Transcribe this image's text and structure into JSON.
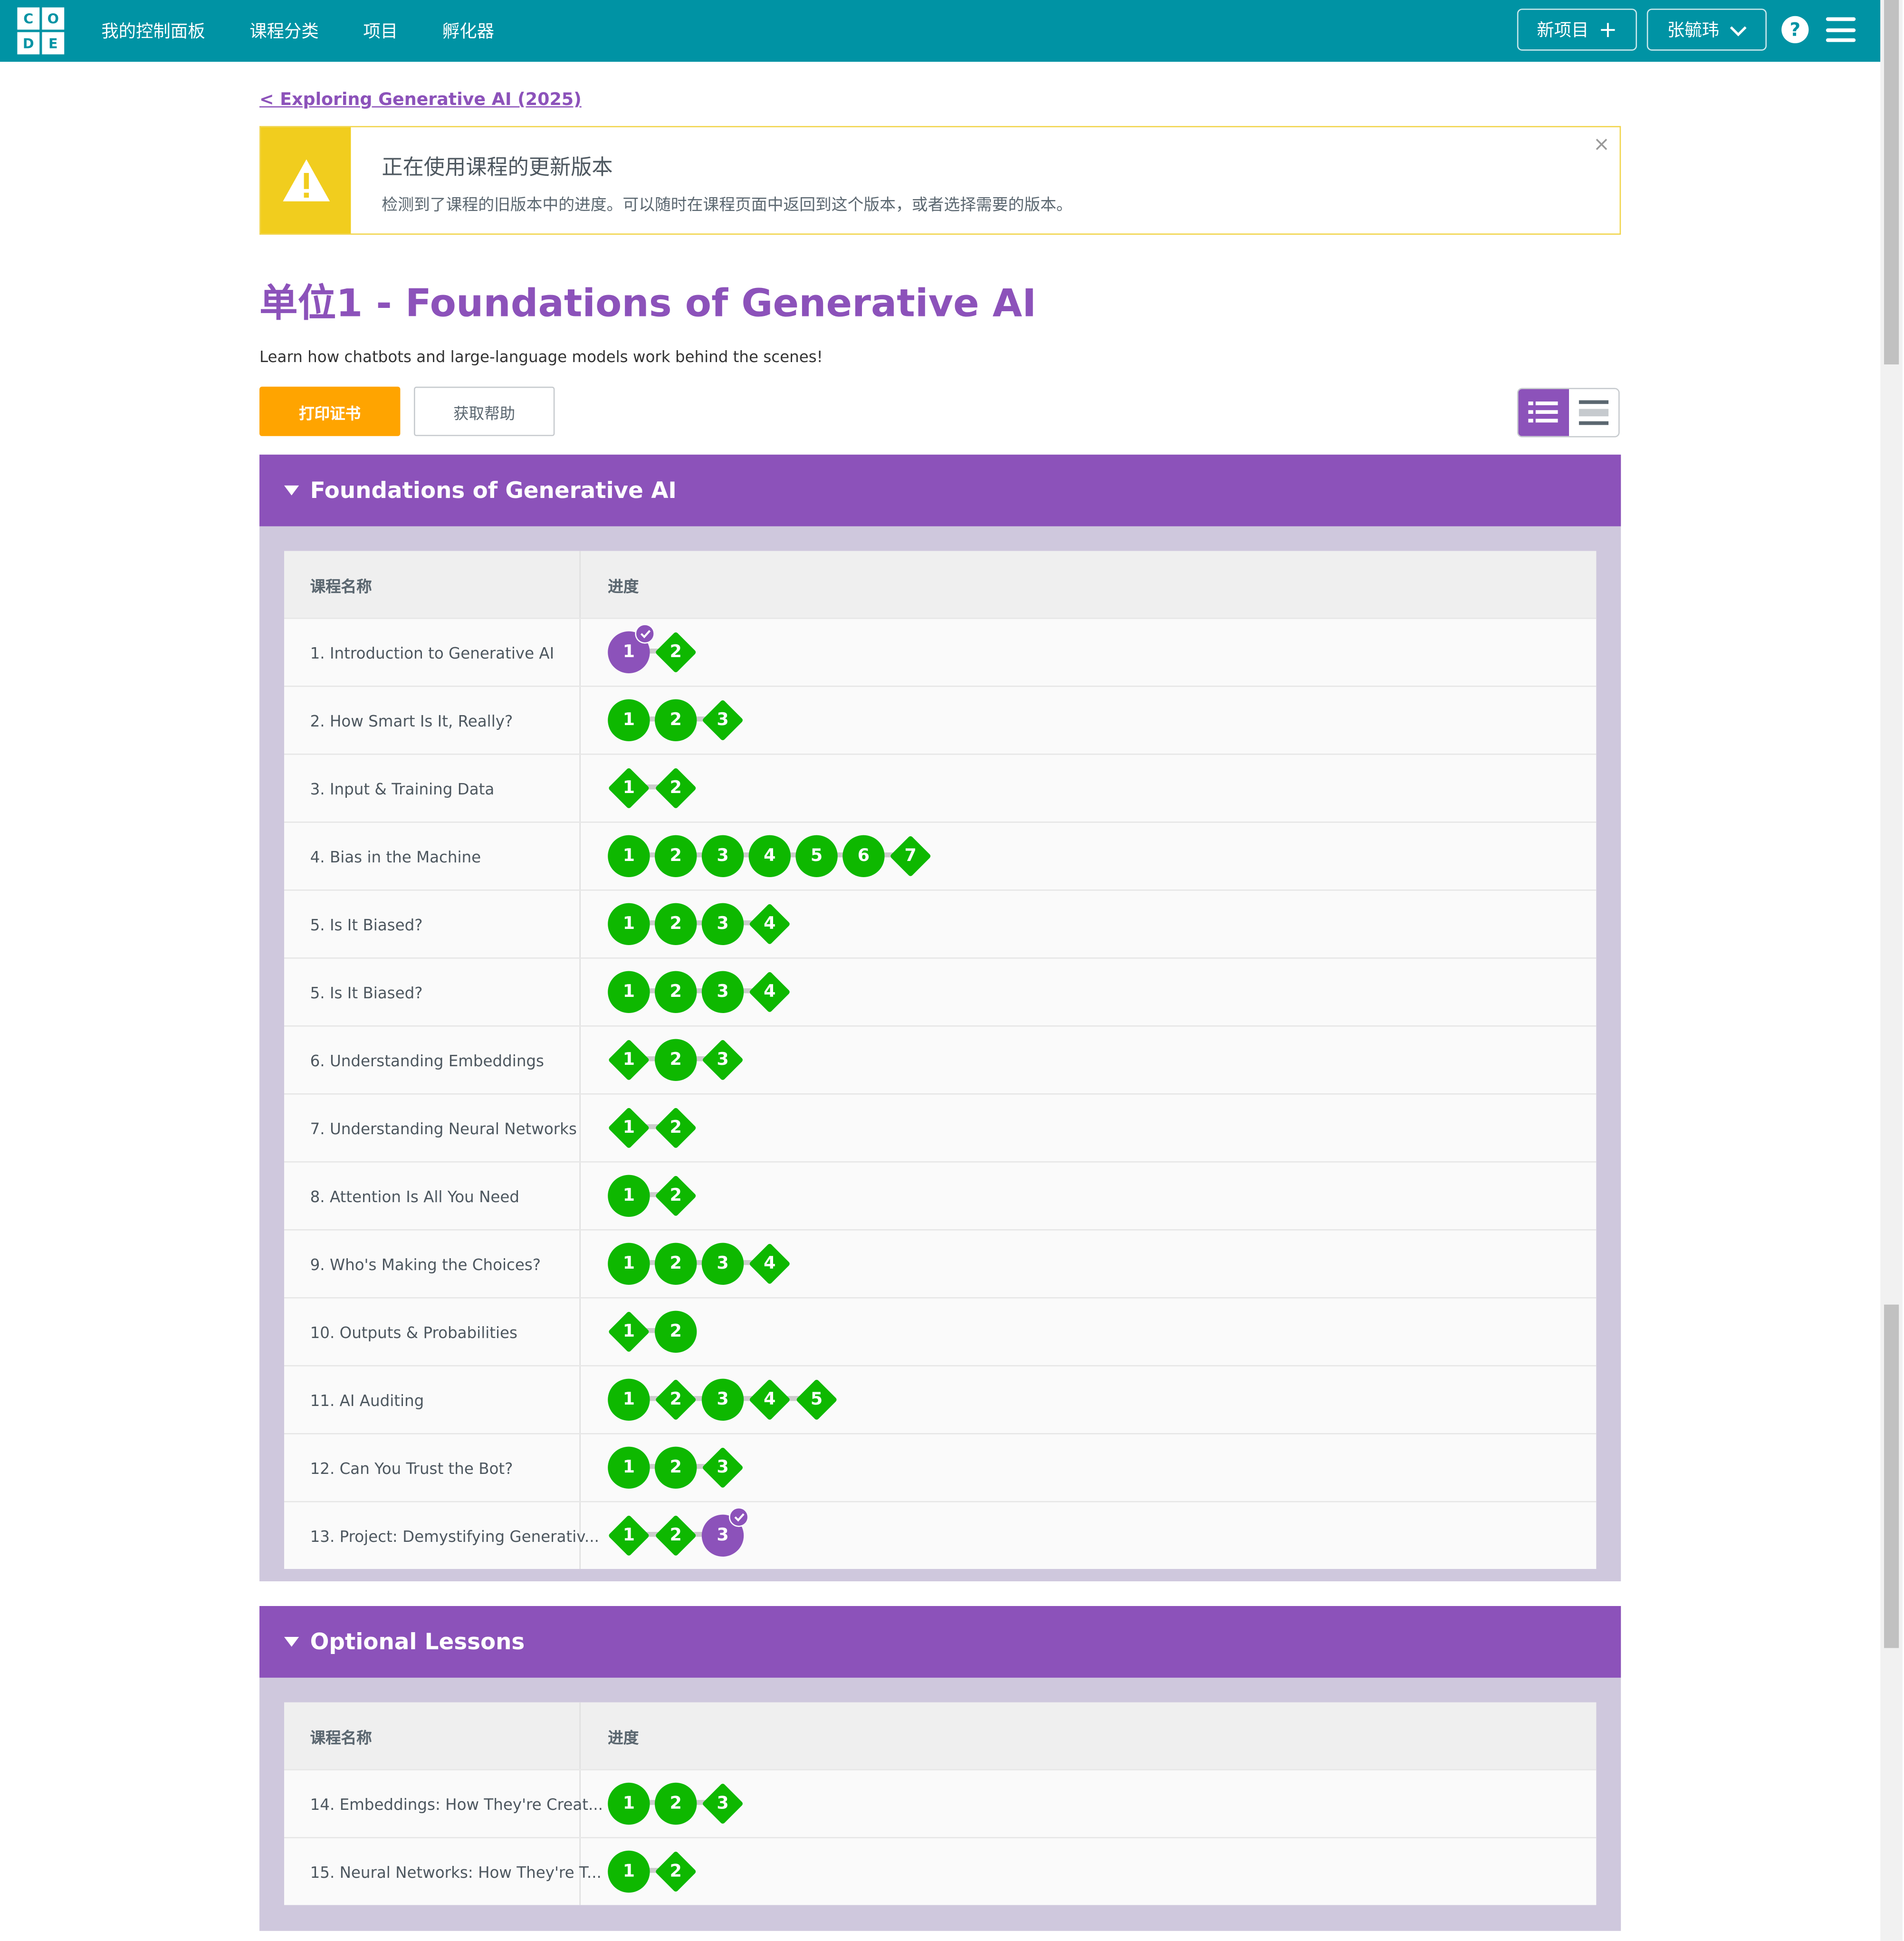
{
  "nav": {
    "logo_letters": [
      "C",
      "O",
      "D",
      "E"
    ],
    "links": [
      "我的控制面板",
      "课程分类",
      "项目",
      "孵化器"
    ],
    "new_project": "新项目",
    "user_name": "张毓玮",
    "help_glyph": "?"
  },
  "back_link": "< Exploring Generative AI (2025)",
  "notice": {
    "title": "正在使用课程的更新版本",
    "body": "检测到了课程的旧版本中的进度。可以随时在课程页面中返回到这个版本，或者选择需要的版本。",
    "close_glyph": "×"
  },
  "unit": {
    "title": "单位1 - Foundations of Generative AI",
    "description": "Learn how chatbots and large-language models work behind the scenes!"
  },
  "buttons": {
    "print": "打印证书",
    "help": "获取帮助"
  },
  "colors": {
    "brand_teal": "#0093a4",
    "accent_purple": "#8c52ba",
    "complete_green": "#0eb800",
    "warning_yellow": "#f1cd1e",
    "print_orange": "#ffa400"
  },
  "sections": [
    {
      "title": "Foundations of Generative AI",
      "col_name": "课程名称",
      "col_progress": "进度",
      "lessons": [
        {
          "name": "1. Introduction to Generative AI",
          "levels": [
            {
              "n": "1",
              "shape": "circle",
              "state": "current"
            },
            {
              "n": "2",
              "shape": "diamond",
              "state": "complete"
            }
          ]
        },
        {
          "name": "2. How Smart Is It, Really?",
          "levels": [
            {
              "n": "1",
              "shape": "circle",
              "state": "complete"
            },
            {
              "n": "2",
              "shape": "circle",
              "state": "complete"
            },
            {
              "n": "3",
              "shape": "diamond",
              "state": "complete"
            }
          ]
        },
        {
          "name": "3. Input & Training Data",
          "levels": [
            {
              "n": "1",
              "shape": "diamond",
              "state": "complete"
            },
            {
              "n": "2",
              "shape": "diamond",
              "state": "complete"
            }
          ]
        },
        {
          "name": "4. Bias in the Machine",
          "levels": [
            {
              "n": "1",
              "shape": "circle",
              "state": "complete"
            },
            {
              "n": "2",
              "shape": "circle",
              "state": "complete"
            },
            {
              "n": "3",
              "shape": "circle",
              "state": "complete"
            },
            {
              "n": "4",
              "shape": "circle",
              "state": "complete"
            },
            {
              "n": "5",
              "shape": "circle",
              "state": "complete"
            },
            {
              "n": "6",
              "shape": "circle",
              "state": "complete"
            },
            {
              "n": "7",
              "shape": "diamond",
              "state": "complete"
            }
          ]
        },
        {
          "name": "5. Is It Biased?",
          "levels": [
            {
              "n": "1",
              "shape": "circle",
              "state": "complete"
            },
            {
              "n": "2",
              "shape": "circle",
              "state": "complete"
            },
            {
              "n": "3",
              "shape": "circle",
              "state": "complete"
            },
            {
              "n": "4",
              "shape": "diamond",
              "state": "complete"
            }
          ]
        },
        {
          "name": "5. Is It Biased?",
          "levels": [
            {
              "n": "1",
              "shape": "circle",
              "state": "complete"
            },
            {
              "n": "2",
              "shape": "circle",
              "state": "complete"
            },
            {
              "n": "3",
              "shape": "circle",
              "state": "complete"
            },
            {
              "n": "4",
              "shape": "diamond",
              "state": "complete"
            }
          ]
        },
        {
          "name": "6. Understanding Embeddings",
          "levels": [
            {
              "n": "1",
              "shape": "diamond",
              "state": "complete"
            },
            {
              "n": "2",
              "shape": "circle",
              "state": "complete"
            },
            {
              "n": "3",
              "shape": "diamond",
              "state": "complete"
            }
          ]
        },
        {
          "name": "7. Understanding Neural Networks",
          "levels": [
            {
              "n": "1",
              "shape": "diamond",
              "state": "complete"
            },
            {
              "n": "2",
              "shape": "diamond",
              "state": "complete"
            }
          ]
        },
        {
          "name": "8. Attention Is All You Need",
          "levels": [
            {
              "n": "1",
              "shape": "circle",
              "state": "complete"
            },
            {
              "n": "2",
              "shape": "diamond",
              "state": "complete"
            }
          ]
        },
        {
          "name": "9. Who's Making the Choices?",
          "levels": [
            {
              "n": "1",
              "shape": "circle",
              "state": "complete"
            },
            {
              "n": "2",
              "shape": "circle",
              "state": "complete"
            },
            {
              "n": "3",
              "shape": "circle",
              "state": "complete"
            },
            {
              "n": "4",
              "shape": "diamond",
              "state": "complete"
            }
          ]
        },
        {
          "name": "10. Outputs & Probabilities",
          "levels": [
            {
              "n": "1",
              "shape": "diamond",
              "state": "complete"
            },
            {
              "n": "2",
              "shape": "circle",
              "state": "complete"
            }
          ]
        },
        {
          "name": "11. AI Auditing",
          "levels": [
            {
              "n": "1",
              "shape": "circle",
              "state": "complete"
            },
            {
              "n": "2",
              "shape": "diamond",
              "state": "complete"
            },
            {
              "n": "3",
              "shape": "circle",
              "state": "complete"
            },
            {
              "n": "4",
              "shape": "diamond",
              "state": "complete"
            },
            {
              "n": "5",
              "shape": "diamond",
              "state": "complete"
            }
          ]
        },
        {
          "name": "12. Can You Trust the Bot?",
          "levels": [
            {
              "n": "1",
              "shape": "circle",
              "state": "complete"
            },
            {
              "n": "2",
              "shape": "circle",
              "state": "complete"
            },
            {
              "n": "3",
              "shape": "diamond",
              "state": "complete"
            }
          ]
        },
        {
          "name": "13. Project: Demystifying Generativ...",
          "levels": [
            {
              "n": "1",
              "shape": "diamond",
              "state": "complete"
            },
            {
              "n": "2",
              "shape": "diamond",
              "state": "complete"
            },
            {
              "n": "3",
              "shape": "circle",
              "state": "current"
            }
          ]
        }
      ]
    },
    {
      "title": "Optional Lessons",
      "col_name": "课程名称",
      "col_progress": "进度",
      "lessons": [
        {
          "name": "14. Embeddings: How They're Creat...",
          "levels": [
            {
              "n": "1",
              "shape": "circle",
              "state": "complete"
            },
            {
              "n": "2",
              "shape": "circle",
              "state": "complete"
            },
            {
              "n": "3",
              "shape": "diamond",
              "state": "complete"
            }
          ]
        },
        {
          "name": "15. Neural Networks: How They're T...",
          "levels": [
            {
              "n": "1",
              "shape": "circle",
              "state": "complete"
            },
            {
              "n": "2",
              "shape": "diamond",
              "state": "complete"
            }
          ]
        }
      ]
    }
  ]
}
